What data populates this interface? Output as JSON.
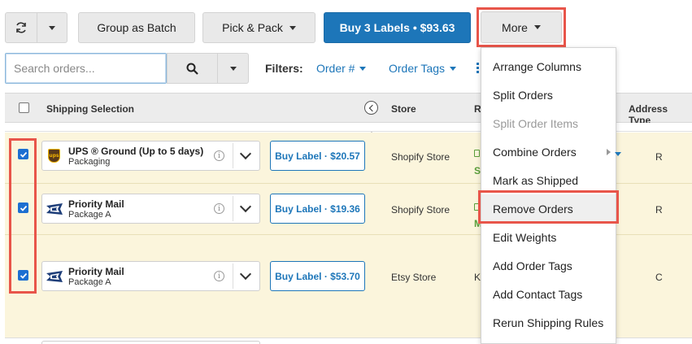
{
  "toolbar": {
    "group_as_batch": "Group as Batch",
    "pick_and_pack": "Pick & Pack",
    "buy_labels": "Buy 3 Labels • $93.63",
    "more": "More"
  },
  "search": {
    "placeholder": "Search orders..."
  },
  "filters": {
    "label": "Filters:",
    "items": [
      "Order #",
      "Order Tags"
    ]
  },
  "table": {
    "columns": {
      "shipping_selection": "Shipping Selection",
      "store": "Store",
      "r_partial": "R",
      "address_type": "Address Type"
    },
    "rows": [
      {
        "carrier": "UPS ® Ground (Up to 5 days)",
        "package": "Packaging",
        "carrier_icon": "ups-logo-icon",
        "buy_label": "Buy Label · $20.57",
        "store": "Shopify Store",
        "r_fragment": "S",
        "address_type": "R",
        "checked": true
      },
      {
        "carrier": "Priority Mail",
        "package": "Package A",
        "carrier_icon": "usps-eagle-icon",
        "buy_label": "Buy Label · $19.36",
        "store": "Shopify Store",
        "r_fragment": "M",
        "address_type": "R",
        "checked": true
      },
      {
        "carrier": "Priority Mail",
        "package": "Package A",
        "carrier_icon": "usps-eagle-icon",
        "buy_label": "Buy Label · $53.70",
        "store": "Etsy Store",
        "r_fragment": "K",
        "address_type": "C",
        "checked": true
      }
    ]
  },
  "more_menu": {
    "items": [
      "Arrange Columns",
      "Split Orders",
      "Split Order Items",
      "Combine Orders",
      "Mark as Shipped",
      "Remove Orders",
      "Edit Weights",
      "Add Order Tags",
      "Add Contact Tags",
      "Rerun Shipping Rules"
    ],
    "disabled": [
      "Split Order Items"
    ],
    "highlighted": "Remove Orders"
  },
  "colors": {
    "accent_blue": "#1d76b9",
    "highlight_red": "#e8554a",
    "row_background": "#fbf5dc",
    "checkbox_blue": "#1c6fd1"
  }
}
